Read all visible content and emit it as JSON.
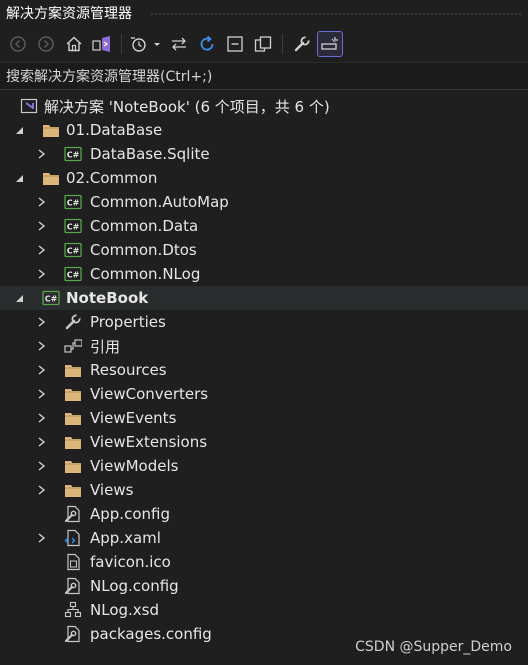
{
  "window": {
    "title": "解决方案资源管理器"
  },
  "toolbar": {
    "buttons": [
      "back-icon",
      "forward-icon",
      "home-icon",
      "vs-switch-icon",
      "history-icon",
      "sync-icon",
      "refresh-icon",
      "collapse-all-icon",
      "show-all-files-icon",
      "properties-wrench-icon",
      "preview-icon"
    ]
  },
  "search": {
    "placeholder": "搜索解决方案资源管理器(Ctrl+;)"
  },
  "tree": {
    "solution": "解决方案 'NoteBook' (6 个项目，共 6 个)",
    "folder1": "01.DataBase",
    "proj_sqlite": "DataBase.Sqlite",
    "folder2": "02.Common",
    "proj_automap": "Common.AutoMap",
    "proj_data": "Common.Data",
    "proj_dtos": "Common.Dtos",
    "proj_nlog": "Common.NLog",
    "proj_notebook": "NoteBook",
    "properties": "Properties",
    "references": "引用",
    "resources": "Resources",
    "viewconverters": "ViewConverters",
    "viewevents": "ViewEvents",
    "viewextensions": "ViewExtensions",
    "viewmodels": "ViewModels",
    "views": "Views",
    "appconfig": "App.config",
    "appxaml": "App.xaml",
    "favicon": "favicon.ico",
    "nlogconfig": "NLog.config",
    "nlogxsd": "NLog.xsd",
    "packages": "packages.config"
  },
  "watermark": "CSDN @Supper_Demo",
  "colors": {
    "background": "#1f1f1f",
    "selection": "#2a2d2e",
    "csharp_green": "#57a64a",
    "folder": "#dcb67a",
    "accent": "#6b6bd6"
  }
}
